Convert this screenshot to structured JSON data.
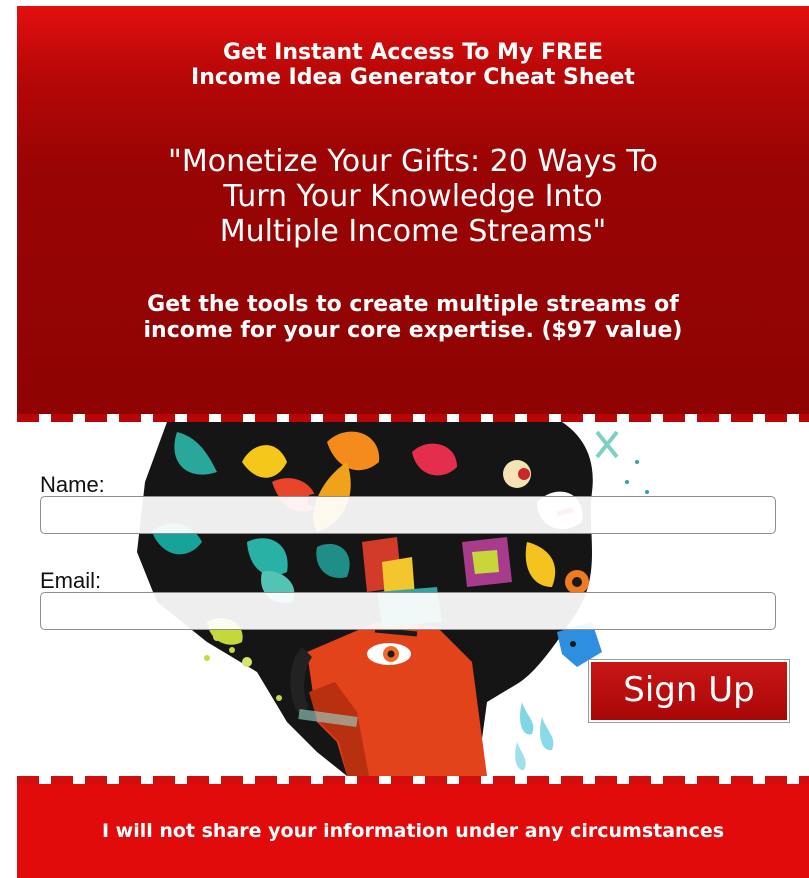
{
  "header": {
    "headline": "Get Instant Access To My FREE\nIncome Idea Generator Cheat Sheet",
    "title": "\"Monetize Your Gifts: 20 Ways To\nTurn Your Knowledge Into\nMultiple Income Streams\"",
    "subtitle": "Get the tools to create multiple streams of\nincome for your core expertise. ($97 value)"
  },
  "form": {
    "name_label": "Name:",
    "name_value": "",
    "email_label": "Email:",
    "email_value": "",
    "submit_label": "Sign Up"
  },
  "footer": {
    "privacy_text": "I will not share your information under any circumstances"
  },
  "colors": {
    "header_red": "#990404",
    "footer_red": "#e10b0b",
    "button_red": "#b80d0d"
  },
  "illustration": {
    "icon": "colorful-head-illustration"
  }
}
